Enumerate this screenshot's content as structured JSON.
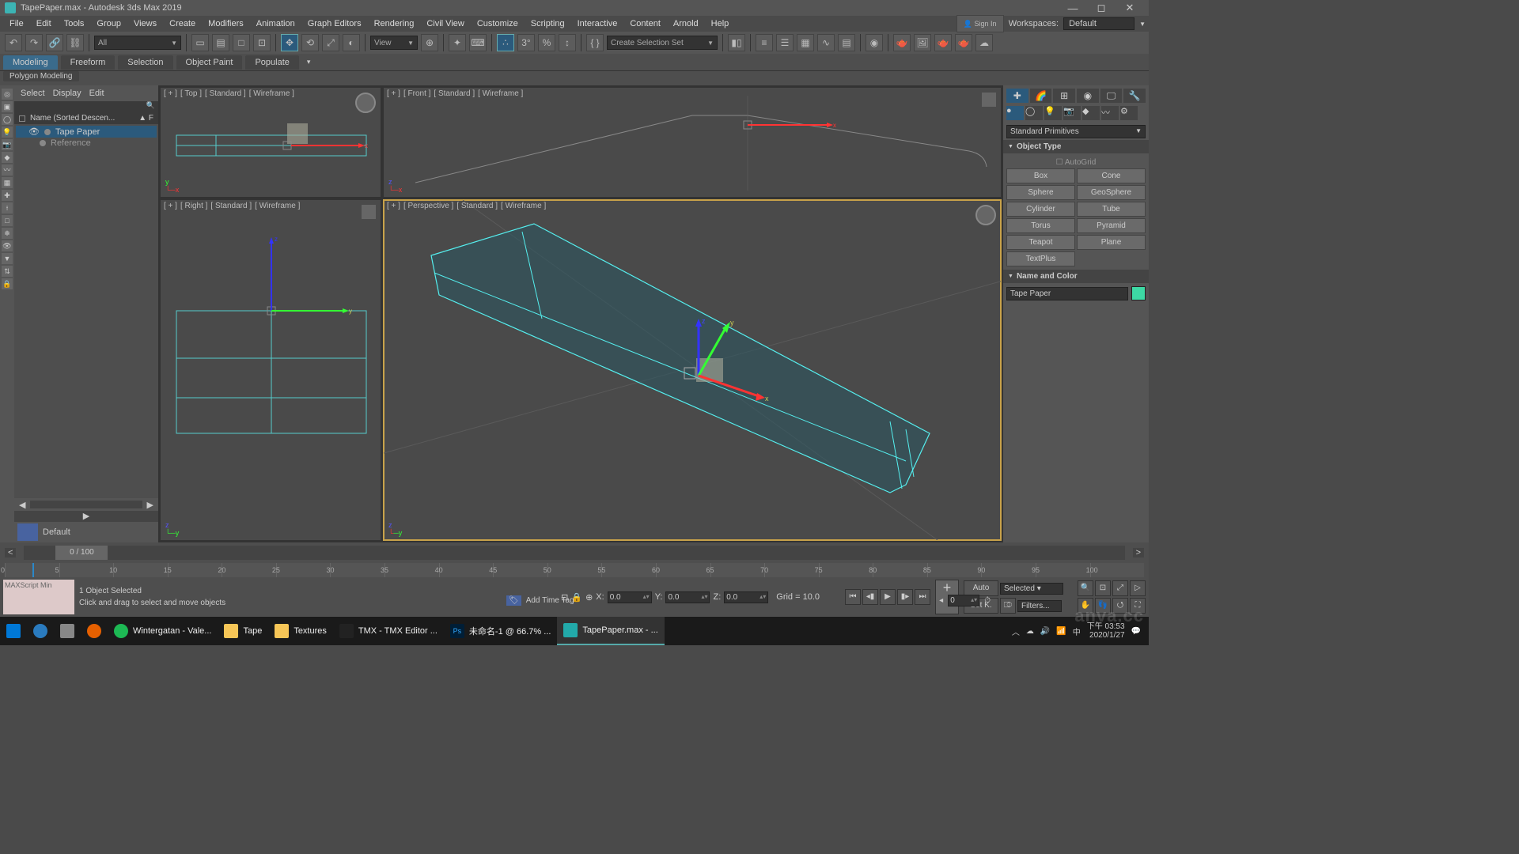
{
  "title": "TapePaper.max - Autodesk 3ds Max 2019",
  "workspaces_label": "Workspaces:",
  "workspace": "Default",
  "menus": [
    "File",
    "Edit",
    "Tools",
    "Group",
    "Views",
    "Create",
    "Modifiers",
    "Animation",
    "Graph Editors",
    "Rendering",
    "Civil View",
    "Customize",
    "Scripting",
    "Interactive",
    "Content",
    "Arnold",
    "Help"
  ],
  "toolbar": {
    "layer_filter": "All",
    "view_label": "View",
    "sel_set": "Create Selection Set"
  },
  "ribbon_tabs": [
    "Modeling",
    "Freeform",
    "Selection",
    "Object Paint",
    "Populate"
  ],
  "poly_tab": "Polygon Modeling",
  "scene": {
    "menu": [
      "Select",
      "Display",
      "Edit"
    ],
    "header": "Name (Sorted Descen...",
    "header_col2": "▲ F",
    "items": [
      {
        "name": "Tape Paper",
        "sel": true,
        "indent": 0
      },
      {
        "name": "Reference",
        "sel": false,
        "indent": 1
      }
    ],
    "layer": "Default"
  },
  "viewports": {
    "top": {
      "labels": [
        "[ + ]",
        "[ Top ]",
        "[ Standard ]",
        "[ Wireframe ]"
      ]
    },
    "front": {
      "labels": [
        "[ + ]",
        "[ Front ]",
        "[ Standard ]",
        "[ Wireframe ]"
      ]
    },
    "right": {
      "labels": [
        "[ + ]",
        "[ Right ]",
        "[ Standard ]",
        "[ Wireframe ]"
      ]
    },
    "persp": {
      "labels": [
        "[ + ]",
        "[ Perspective ]",
        "[ Standard ]",
        "[ Wireframe ]"
      ]
    }
  },
  "cmd": {
    "category": "Standard Primitives",
    "roll1": "Object Type",
    "autogrid": "AutoGrid",
    "prims": [
      "Box",
      "Cone",
      "Sphere",
      "GeoSphere",
      "Cylinder",
      "Tube",
      "Torus",
      "Pyramid",
      "Teapot",
      "Plane",
      "TextPlus"
    ],
    "roll2": "Name and Color",
    "obj_name": "Tape Paper"
  },
  "time": {
    "frame": "0 / 100",
    "ticks": [
      "0",
      "5",
      "10",
      "15",
      "20",
      "25",
      "30",
      "35",
      "40",
      "45",
      "50",
      "55",
      "60",
      "65",
      "70",
      "75",
      "80",
      "85",
      "90",
      "95",
      "100"
    ]
  },
  "status": {
    "ms": "MAXScript Min",
    "sel": "1 Object Selected",
    "hint": "Click and drag to select and move objects",
    "x": "0.0",
    "y": "0.0",
    "z": "0.0",
    "grid": "Grid = 10.0",
    "addtime": "Add Time Tag",
    "auto": "Auto",
    "setk": "Set K.",
    "keymode": "Selected",
    "filters": "Filters...",
    "keyspin": "0"
  },
  "taskbar": {
    "items": [
      {
        "label": "",
        "icon": "win"
      },
      {
        "label": "",
        "icon": "cortana"
      },
      {
        "label": "",
        "icon": "taskview"
      },
      {
        "label": "",
        "icon": "firefox"
      },
      {
        "label": "Wintergatan - Vale...",
        "icon": "spotify"
      },
      {
        "label": "Tape",
        "icon": "folder"
      },
      {
        "label": "Textures",
        "icon": "folder"
      },
      {
        "label": "TMX - TMX Editor ...",
        "icon": "unity"
      },
      {
        "label": "未命名-1 @ 66.7% ...",
        "icon": "ps"
      },
      {
        "label": "TapePaper.max - ...",
        "icon": "max",
        "active": true
      }
    ],
    "time": "下午 03:53",
    "date": "2020/1/27"
  },
  "watermark": "anva.cc"
}
